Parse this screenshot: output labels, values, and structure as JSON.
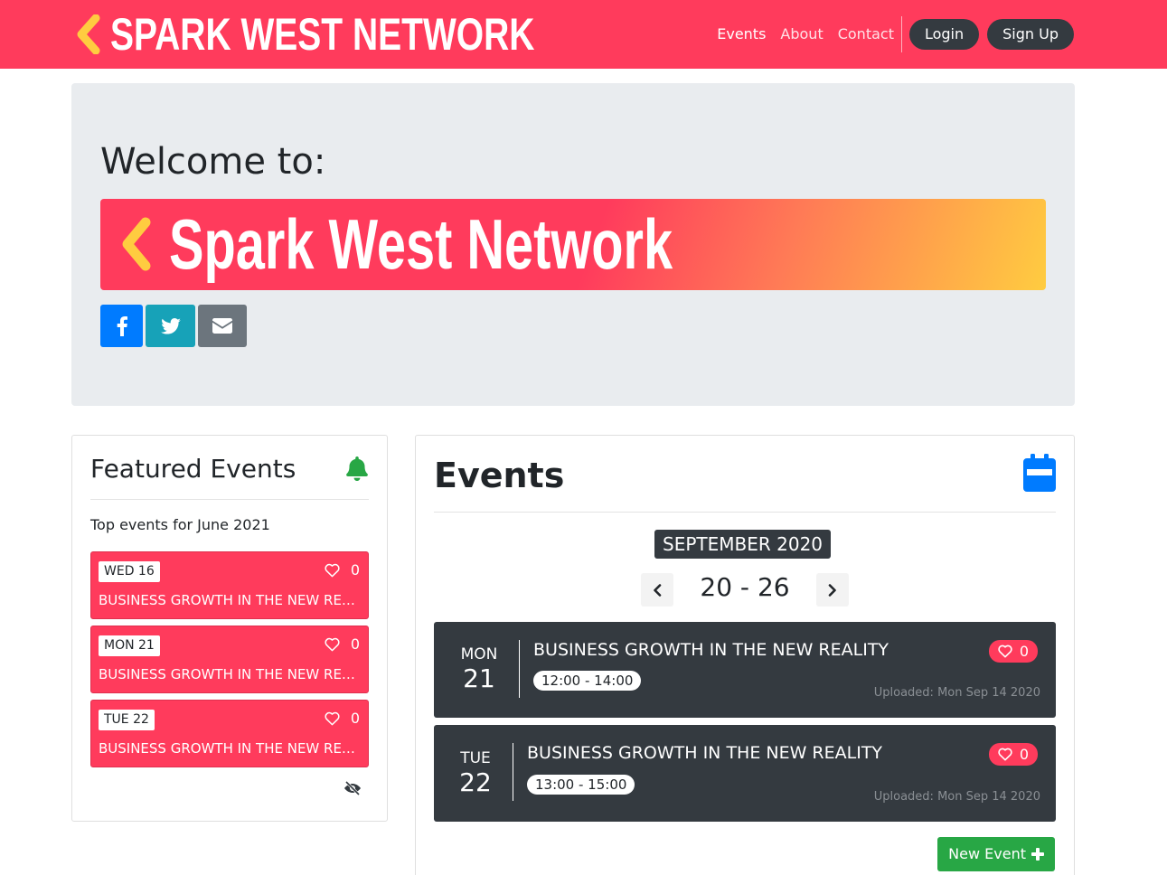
{
  "navbar": {
    "brand": "Spark West Network",
    "links": [
      "Events",
      "About",
      "Contact"
    ],
    "login_label": "Login",
    "signup_label": "Sign Up"
  },
  "jumbotron": {
    "welcome": "Welcome to:",
    "banner_text": "Spark West Network",
    "share": [
      "facebook-icon",
      "twitter-icon",
      "envelope-icon"
    ]
  },
  "featured": {
    "title": "Featured Events",
    "subtitle": "Top events for June 2021",
    "items": [
      {
        "date": "WED 16",
        "likes": "0",
        "name": "BUSINESS GROWTH IN THE NEW REALITY"
      },
      {
        "date": "MON 21",
        "likes": "0",
        "name": "BUSINESS GROWTH IN THE NEW REALITY"
      },
      {
        "date": "TUE 22",
        "likes": "0",
        "name": "BUSINESS GROWTH IN THE NEW REALITY"
      }
    ]
  },
  "events": {
    "title": "Events",
    "month": "SEPTEMBER 2020",
    "week_range": "20 - 26",
    "items": [
      {
        "day": "MON",
        "num": "21",
        "name": "BUSINESS GROWTH IN THE NEW REALITY",
        "time": "12:00 - 14:00",
        "likes": "0",
        "uploaded": "Uploaded: Mon Sep 14 2020"
      },
      {
        "day": "TUE",
        "num": "22",
        "name": "BUSINESS GROWTH IN THE NEW REALITY",
        "time": "13:00 - 15:00",
        "likes": "0",
        "uploaded": "Uploaded: Mon Sep 14 2020"
      }
    ],
    "new_event_label": "New Event"
  },
  "colors": {
    "brand_red": "#ff3b5c",
    "brand_yellow": "#ffcc40",
    "dark": "#343a40",
    "success": "#28a745",
    "primary": "#007bff",
    "info": "#17a2b8",
    "secondary": "#6c757d"
  }
}
